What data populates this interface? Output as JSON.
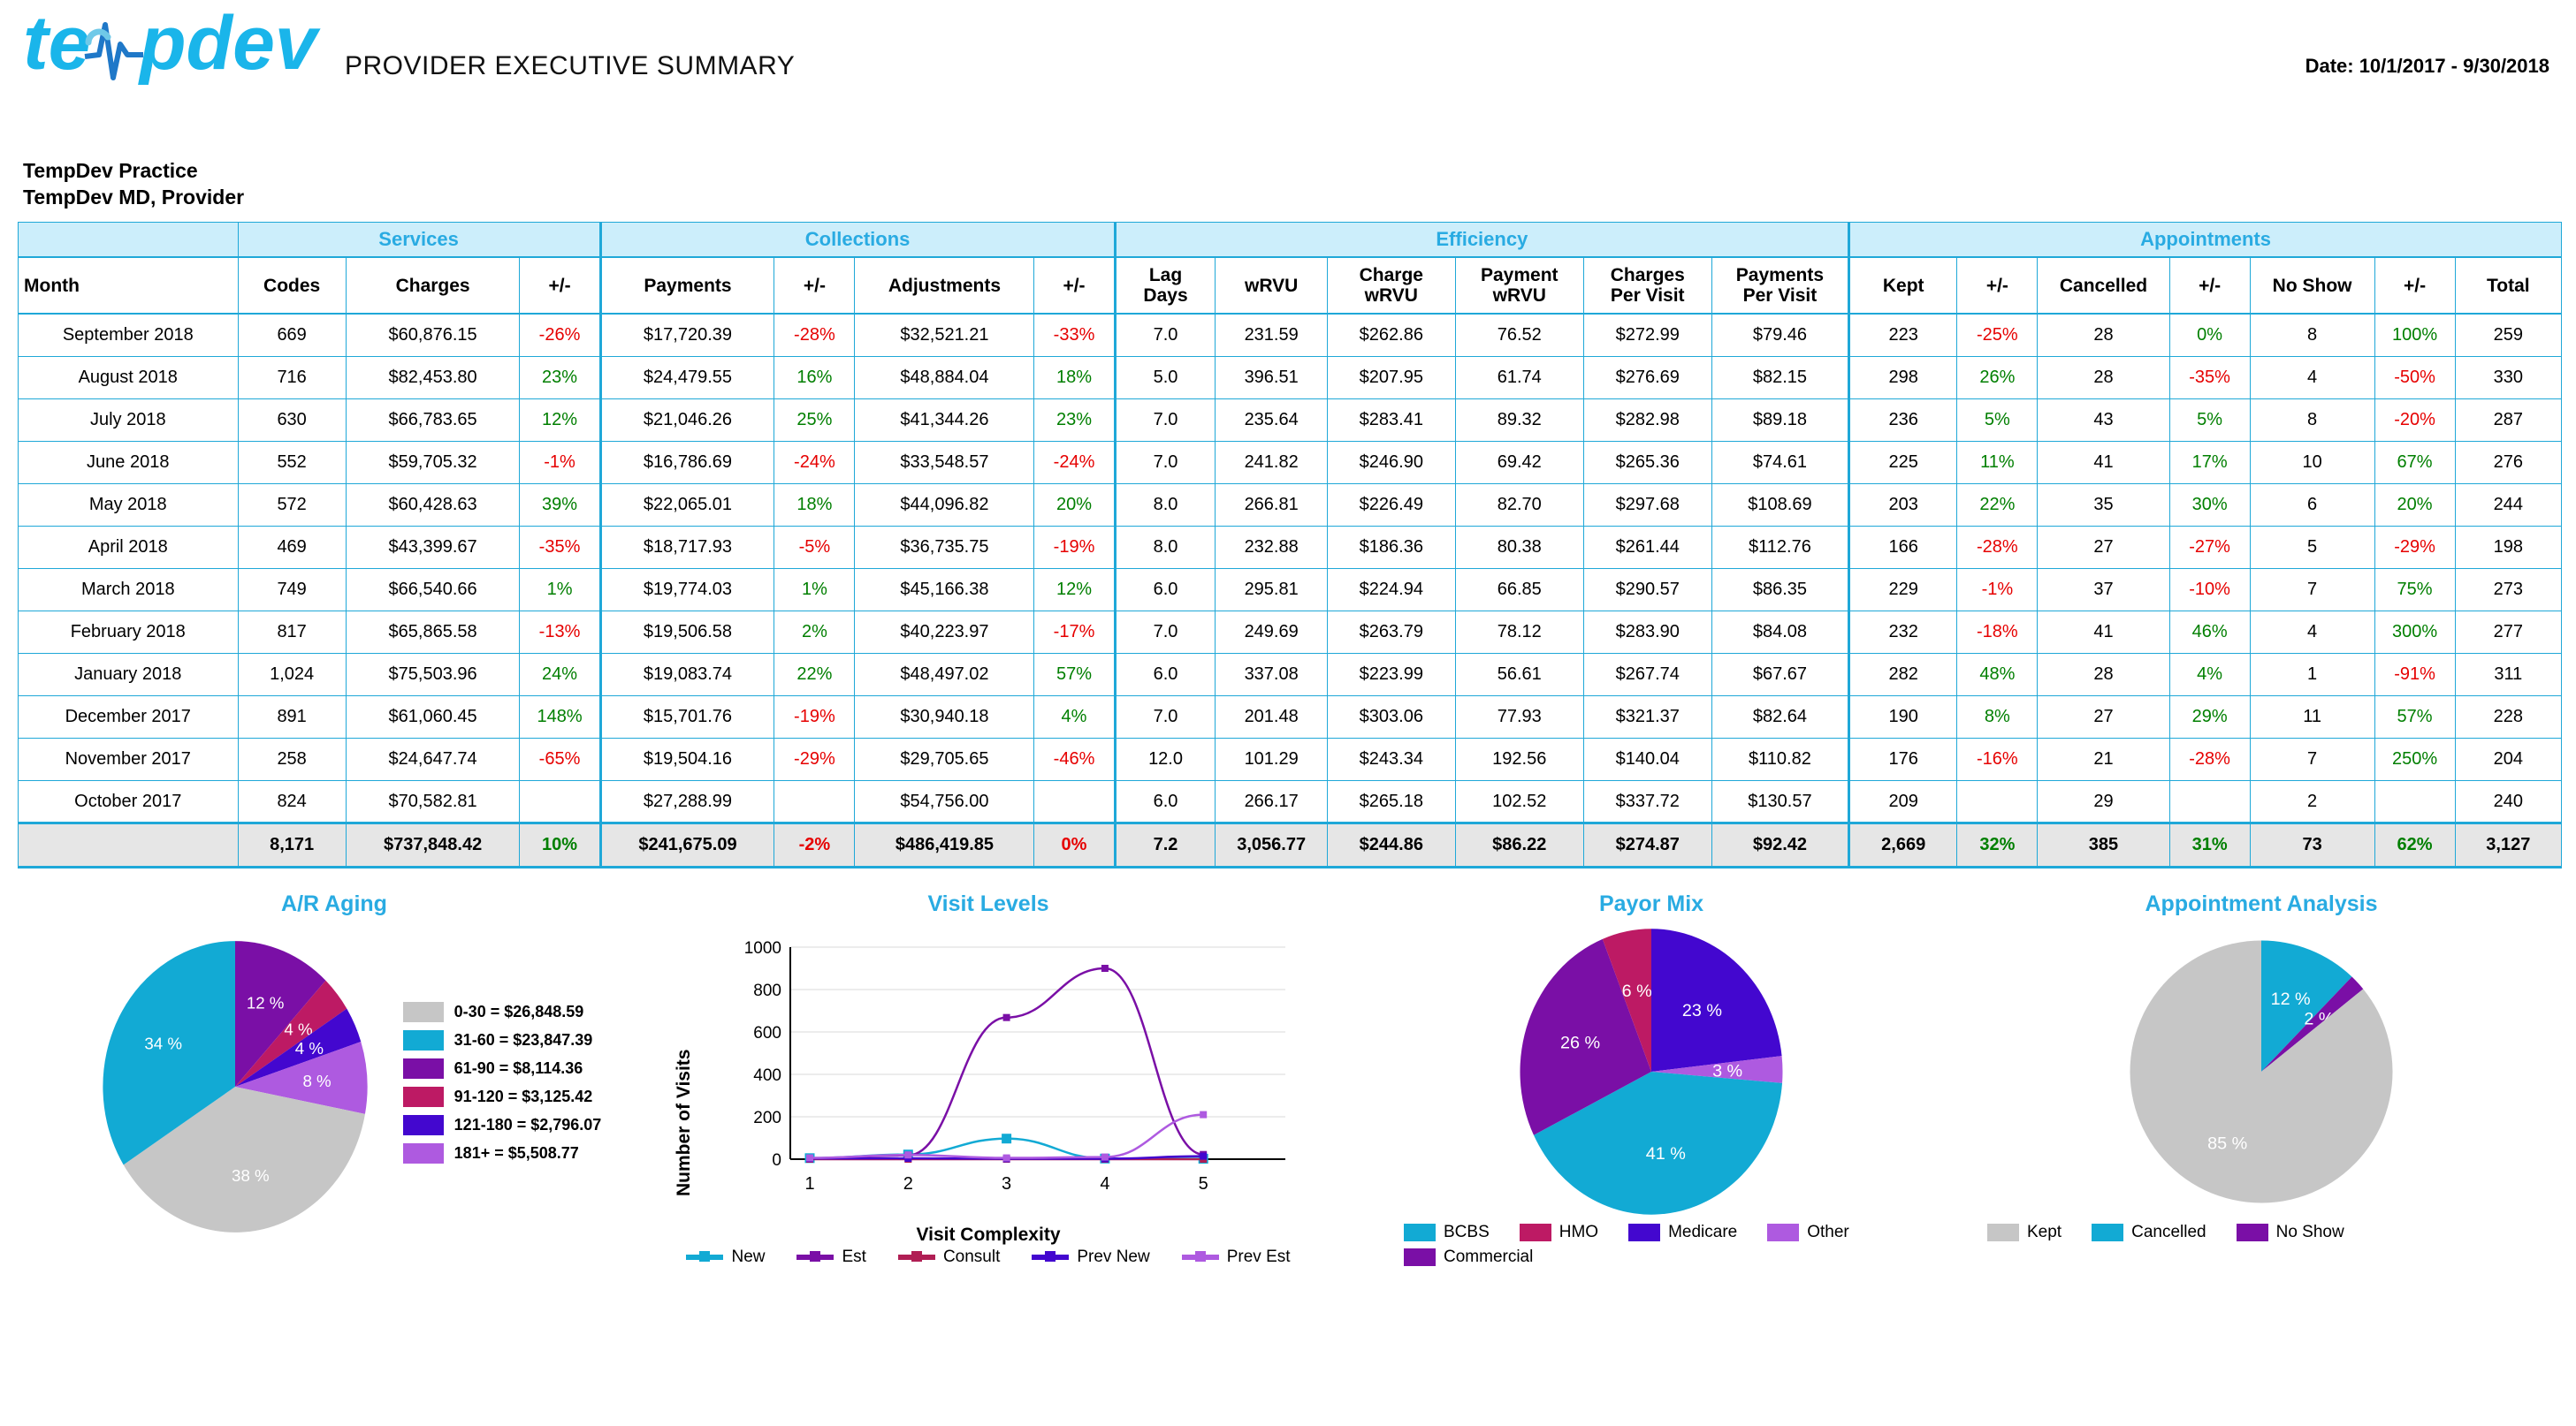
{
  "header": {
    "logo_text": "tempdev",
    "logo_icon": "heartbeat-pulse-icon",
    "report_title": "PROVIDER EXECUTIVE SUMMARY",
    "date_range": "Date: 10/1/2017 - 9/30/2018"
  },
  "practice": {
    "name": "TempDev Practice",
    "provider": "TempDev MD, Provider"
  },
  "table": {
    "groups": [
      {
        "label": "",
        "span": 1
      },
      {
        "label": "Services",
        "span": 3
      },
      {
        "label": "Collections",
        "span": 4
      },
      {
        "label": "Efficiency",
        "span": 6
      },
      {
        "label": "Appointments",
        "span": 7
      }
    ],
    "columns": [
      "Month",
      "Codes",
      "Charges",
      "+/-",
      "Payments",
      "+/-",
      "Adjustments",
      "+/-",
      "Lag Days",
      "wRVU",
      "Charge wRVU",
      "Payment wRVU",
      "Charges Per Visit",
      "Payments Per Visit",
      "Kept",
      "+/-",
      "Cancelled",
      "+/-",
      "No Show",
      "+/-",
      "Total"
    ],
    "columns_two_line": {
      "8": [
        "Lag",
        "Days"
      ],
      "10": [
        "Charge",
        "wRVU"
      ],
      "11": [
        "Payment",
        "wRVU"
      ],
      "12": [
        "Charges",
        "Per Visit"
      ],
      "13": [
        "Payments",
        "Per Visit"
      ]
    },
    "rows": [
      {
        "month": "September 2018",
        "codes": "669",
        "charges": "$60,876.15",
        "charges_pct": "-26%",
        "payments": "$17,720.39",
        "payments_pct": "-28%",
        "adjustments": "$32,521.21",
        "adjustments_pct": "-33%",
        "lag_days": "7.0",
        "wrvu": "231.59",
        "charge_wrvu": "$262.86",
        "payment_wrvu": "76.52",
        "charges_per_visit": "$272.99",
        "payments_per_visit": "$79.46",
        "kept": "223",
        "kept_pct": "-25%",
        "cancelled": "28",
        "cancelled_pct": "0%",
        "no_show": "8",
        "no_show_pct": "100%",
        "total": "259"
      },
      {
        "month": "August 2018",
        "codes": "716",
        "charges": "$82,453.80",
        "charges_pct": "23%",
        "payments": "$24,479.55",
        "payments_pct": "16%",
        "adjustments": "$48,884.04",
        "adjustments_pct": "18%",
        "lag_days": "5.0",
        "wrvu": "396.51",
        "charge_wrvu": "$207.95",
        "payment_wrvu": "61.74",
        "charges_per_visit": "$276.69",
        "payments_per_visit": "$82.15",
        "kept": "298",
        "kept_pct": "26%",
        "cancelled": "28",
        "cancelled_pct": "-35%",
        "no_show": "4",
        "no_show_pct": "-50%",
        "total": "330"
      },
      {
        "month": "July 2018",
        "codes": "630",
        "charges": "$66,783.65",
        "charges_pct": "12%",
        "payments": "$21,046.26",
        "payments_pct": "25%",
        "adjustments": "$41,344.26",
        "adjustments_pct": "23%",
        "lag_days": "7.0",
        "wrvu": "235.64",
        "charge_wrvu": "$283.41",
        "payment_wrvu": "89.32",
        "charges_per_visit": "$282.98",
        "payments_per_visit": "$89.18",
        "kept": "236",
        "kept_pct": "5%",
        "cancelled": "43",
        "cancelled_pct": "5%",
        "no_show": "8",
        "no_show_pct": "-20%",
        "total": "287"
      },
      {
        "month": "June 2018",
        "codes": "552",
        "charges": "$59,705.32",
        "charges_pct": "-1%",
        "payments": "$16,786.69",
        "payments_pct": "-24%",
        "adjustments": "$33,548.57",
        "adjustments_pct": "-24%",
        "lag_days": "7.0",
        "wrvu": "241.82",
        "charge_wrvu": "$246.90",
        "payment_wrvu": "69.42",
        "charges_per_visit": "$265.36",
        "payments_per_visit": "$74.61",
        "kept": "225",
        "kept_pct": "11%",
        "cancelled": "41",
        "cancelled_pct": "17%",
        "no_show": "10",
        "no_show_pct": "67%",
        "total": "276"
      },
      {
        "month": "May 2018",
        "codes": "572",
        "charges": "$60,428.63",
        "charges_pct": "39%",
        "payments": "$22,065.01",
        "payments_pct": "18%",
        "adjustments": "$44,096.82",
        "adjustments_pct": "20%",
        "lag_days": "8.0",
        "wrvu": "266.81",
        "charge_wrvu": "$226.49",
        "payment_wrvu": "82.70",
        "charges_per_visit": "$297.68",
        "payments_per_visit": "$108.69",
        "kept": "203",
        "kept_pct": "22%",
        "cancelled": "35",
        "cancelled_pct": "30%",
        "no_show": "6",
        "no_show_pct": "20%",
        "total": "244"
      },
      {
        "month": "April 2018",
        "codes": "469",
        "charges": "$43,399.67",
        "charges_pct": "-35%",
        "payments": "$18,717.93",
        "payments_pct": "-5%",
        "adjustments": "$36,735.75",
        "adjustments_pct": "-19%",
        "lag_days": "8.0",
        "wrvu": "232.88",
        "charge_wrvu": "$186.36",
        "payment_wrvu": "80.38",
        "charges_per_visit": "$261.44",
        "payments_per_visit": "$112.76",
        "kept": "166",
        "kept_pct": "-28%",
        "cancelled": "27",
        "cancelled_pct": "-27%",
        "no_show": "5",
        "no_show_pct": "-29%",
        "total": "198"
      },
      {
        "month": "March 2018",
        "codes": "749",
        "charges": "$66,540.66",
        "charges_pct": "1%",
        "payments": "$19,774.03",
        "payments_pct": "1%",
        "adjustments": "$45,166.38",
        "adjustments_pct": "12%",
        "lag_days": "6.0",
        "wrvu": "295.81",
        "charge_wrvu": "$224.94",
        "payment_wrvu": "66.85",
        "charges_per_visit": "$290.57",
        "payments_per_visit": "$86.35",
        "kept": "229",
        "kept_pct": "-1%",
        "cancelled": "37",
        "cancelled_pct": "-10%",
        "no_show": "7",
        "no_show_pct": "75%",
        "total": "273"
      },
      {
        "month": "February 2018",
        "codes": "817",
        "charges": "$65,865.58",
        "charges_pct": "-13%",
        "payments": "$19,506.58",
        "payments_pct": "2%",
        "adjustments": "$40,223.97",
        "adjustments_pct": "-17%",
        "lag_days": "7.0",
        "wrvu": "249.69",
        "charge_wrvu": "$263.79",
        "payment_wrvu": "78.12",
        "charges_per_visit": "$283.90",
        "payments_per_visit": "$84.08",
        "kept": "232",
        "kept_pct": "-18%",
        "cancelled": "41",
        "cancelled_pct": "46%",
        "no_show": "4",
        "no_show_pct": "300%",
        "total": "277"
      },
      {
        "month": "January 2018",
        "codes": "1,024",
        "charges": "$75,503.96",
        "charges_pct": "24%",
        "payments": "$19,083.74",
        "payments_pct": "22%",
        "adjustments": "$48,497.02",
        "adjustments_pct": "57%",
        "lag_days": "6.0",
        "wrvu": "337.08",
        "charge_wrvu": "$223.99",
        "payment_wrvu": "56.61",
        "charges_per_visit": "$267.74",
        "payments_per_visit": "$67.67",
        "kept": "282",
        "kept_pct": "48%",
        "cancelled": "28",
        "cancelled_pct": "4%",
        "no_show": "1",
        "no_show_pct": "-91%",
        "total": "311"
      },
      {
        "month": "December 2017",
        "codes": "891",
        "charges": "$61,060.45",
        "charges_pct": "148%",
        "payments": "$15,701.76",
        "payments_pct": "-19%",
        "adjustments": "$30,940.18",
        "adjustments_pct": "4%",
        "lag_days": "7.0",
        "wrvu": "201.48",
        "charge_wrvu": "$303.06",
        "payment_wrvu": "77.93",
        "charges_per_visit": "$321.37",
        "payments_per_visit": "$82.64",
        "kept": "190",
        "kept_pct": "8%",
        "cancelled": "27",
        "cancelled_pct": "29%",
        "no_show": "11",
        "no_show_pct": "57%",
        "total": "228"
      },
      {
        "month": "November 2017",
        "codes": "258",
        "charges": "$24,647.74",
        "charges_pct": "-65%",
        "payments": "$19,504.16",
        "payments_pct": "-29%",
        "adjustments": "$29,705.65",
        "adjustments_pct": "-46%",
        "lag_days": "12.0",
        "wrvu": "101.29",
        "charge_wrvu": "$243.34",
        "payment_wrvu": "192.56",
        "charges_per_visit": "$140.04",
        "payments_per_visit": "$110.82",
        "kept": "176",
        "kept_pct": "-16%",
        "cancelled": "21",
        "cancelled_pct": "-28%",
        "no_show": "7",
        "no_show_pct": "250%",
        "total": "204"
      },
      {
        "month": "October 2017",
        "codes": "824",
        "charges": "$70,582.81",
        "charges_pct": "",
        "payments": "$27,288.99",
        "payments_pct": "",
        "adjustments": "$54,756.00",
        "adjustments_pct": "",
        "lag_days": "6.0",
        "wrvu": "266.17",
        "charge_wrvu": "$265.18",
        "payment_wrvu": "102.52",
        "charges_per_visit": "$337.72",
        "payments_per_visit": "$130.57",
        "kept": "209",
        "kept_pct": "",
        "cancelled": "29",
        "cancelled_pct": "",
        "no_show": "2",
        "no_show_pct": "",
        "total": "240"
      }
    ],
    "totals": {
      "month": "",
      "codes": "8,171",
      "charges": "$737,848.42",
      "charges_pct": "10%",
      "payments": "$241,675.09",
      "payments_pct": "-2%",
      "adjustments": "$486,419.85",
      "adjustments_pct": "0%",
      "lag_days": "7.2",
      "wrvu": "3,056.77",
      "charge_wrvu": "$244.86",
      "payment_wrvu": "$86.22",
      "charges_per_visit": "$274.87",
      "payments_per_visit": "$92.42",
      "kept": "2,669",
      "kept_pct": "32%",
      "cancelled": "385",
      "cancelled_pct": "31%",
      "no_show": "73",
      "no_show_pct": "62%",
      "total": "3,127"
    }
  },
  "colors": {
    "accent": "#29abe2",
    "border": "#1fa8d8",
    "positive": "#007f00",
    "negative": "#e60000",
    "gray": "#c6c6c6",
    "cyan": "#12aad4",
    "dark_purple": "#7a0fa6",
    "crimson": "#bd1a64",
    "blue_violet": "#4307cf",
    "light_purple": "#ae5ae0",
    "totals_bg": "#e6e6e6"
  },
  "chart_data": [
    {
      "type": "pie",
      "title": "A/R Aging",
      "legend_position": "right",
      "labels": [
        "0-30",
        "31-60",
        "61-90",
        "91-120",
        "121-180",
        "181+"
      ],
      "legend_entries": [
        "0-30 = $26,848.59",
        "31-60 = $23,847.39",
        "61-90 = $8,114.36",
        "91-120 = $3,125.42",
        "121-180 = $2,796.07",
        "181+ = $5,508.77"
      ],
      "values": [
        26848.59,
        23847.39,
        8114.36,
        3125.42,
        2796.07,
        5508.77
      ],
      "percent_labels": [
        "38 %",
        "34 %",
        "12 %",
        "4 %",
        "4 %",
        "8 %"
      ],
      "percents": [
        38,
        34,
        12,
        4,
        4,
        8
      ],
      "slice_colors": [
        "#c6c6c6",
        "#12aad4",
        "#7a0fa6",
        "#bd1a64",
        "#4307cf",
        "#ae5ae0"
      ]
    },
    {
      "type": "line",
      "title": "Visit Levels",
      "xlabel": "Visit Complexity",
      "ylabel": "Number of Visits",
      "x": [
        1,
        2,
        3,
        4,
        5
      ],
      "xticks": [
        "1",
        "2",
        "3",
        "4",
        "5"
      ],
      "yticks": [
        "0",
        "200",
        "400",
        "600",
        "800",
        "1000"
      ],
      "ylim": [
        0,
        1000
      ],
      "grid": true,
      "legend_position": "bottom",
      "series": [
        {
          "name": "New",
          "color": "#12aad4",
          "values": [
            5,
            22,
            97,
            3,
            2
          ]
        },
        {
          "name": "Est",
          "color": "#7a0fa6",
          "values": [
            4,
            18,
            668,
            900,
            22
          ]
        },
        {
          "name": "Consult",
          "color": "#b01e54",
          "values": [
            0,
            0,
            0,
            0,
            0
          ]
        },
        {
          "name": "Prev New",
          "color": "#4307cf",
          "values": [
            3,
            4,
            2,
            2,
            14
          ]
        },
        {
          "name": "Prev Est",
          "color": "#ae5ae0",
          "values": [
            6,
            20,
            6,
            10,
            210
          ]
        }
      ]
    },
    {
      "type": "pie",
      "title": "Payor Mix",
      "legend_position": "bottom",
      "labels": [
        "BCBS",
        "HMO",
        "Medicare",
        "Other",
        "Commercial"
      ],
      "legend_entries": [
        "BCBS",
        "HMO",
        "Medicare",
        "Other",
        "Commercial"
      ],
      "percent_labels": [
        "41 %",
        "6 %",
        "23 %",
        "3 %",
        "26 %"
      ],
      "percents": [
        41,
        6,
        23,
        3,
        26
      ],
      "slice_colors": [
        "#12aad4",
        "#bd1a64",
        "#4307cf",
        "#ae5ae0",
        "#7a0fa6"
      ]
    },
    {
      "type": "pie",
      "title": "Appointment Analysis",
      "legend_position": "bottom",
      "labels": [
        "Kept",
        "Cancelled",
        "No Show"
      ],
      "legend_entries": [
        "Kept",
        "Cancelled",
        "No Show"
      ],
      "percent_labels": [
        "85 %",
        "12 %",
        "2 %"
      ],
      "percents": [
        85,
        12,
        2
      ],
      "slice_colors": [
        "#c6c6c6",
        "#12aad4",
        "#7a0fa6"
      ]
    }
  ]
}
